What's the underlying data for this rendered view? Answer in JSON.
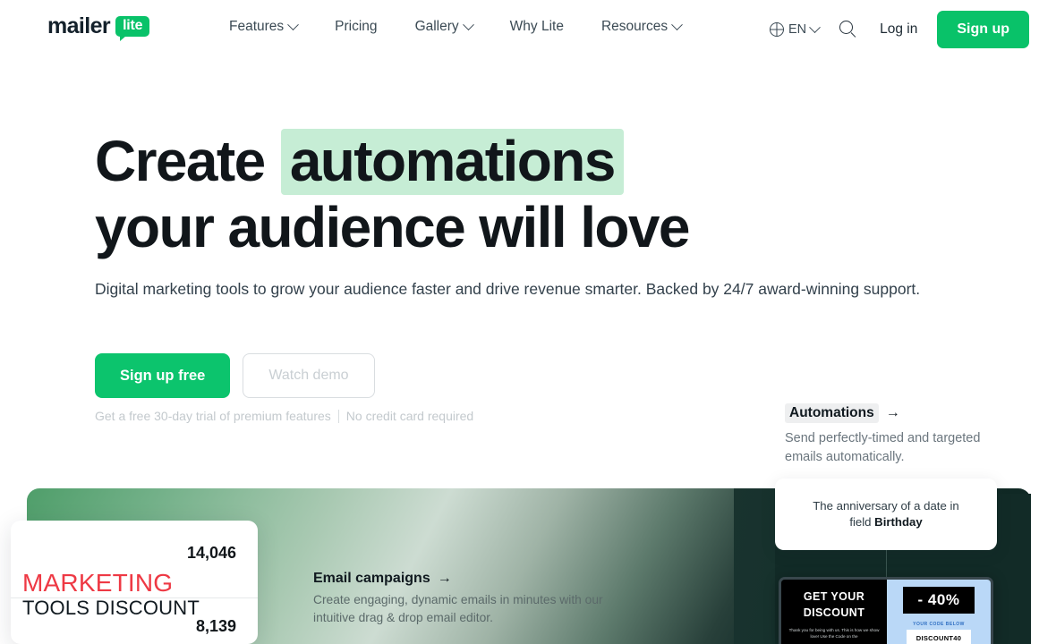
{
  "nav": {
    "logo": {
      "word": "mailer",
      "badge": "lite"
    },
    "links": [
      {
        "label": "Features",
        "has_chevron": true
      },
      {
        "label": "Pricing",
        "has_chevron": false
      },
      {
        "label": "Gallery",
        "has_chevron": true
      },
      {
        "label": "Why Lite",
        "has_chevron": false
      },
      {
        "label": "Resources",
        "has_chevron": true
      }
    ],
    "language": "EN",
    "search_icon": "search-icon",
    "login_label": "Log in",
    "signup_label": "Sign up",
    "accent_color": "#09c269"
  },
  "hero": {
    "title_part1": "Create",
    "title_highlight": "automations",
    "title_part2": "your audience will love",
    "highlight_color": "#c6edd5",
    "subtitle": "Digital marketing tools to grow your audience faster and drive revenue smarter. Backed by 24/7 award-winning support.",
    "primary_button": "Sign up free",
    "secondary_button": "Watch demo",
    "note_left": "Get a free 30-day trial of premium features",
    "note_right": "No credit card required"
  },
  "automations": {
    "badge": "Automations",
    "arrow": "→",
    "description": "Send perfectly-timed and targeted emails automatically."
  },
  "email_campaigns": {
    "heading": "Email campaigns",
    "arrow": "→",
    "description": "Create engaging, dynamic emails in minutes with our intuitive drag & drop email editor."
  },
  "tooltip": {
    "line1": "The anniversary of a date in",
    "line2_prefix": "field ",
    "line2_bold": "Birthday"
  },
  "marketing_card": {
    "number_top": "14,046",
    "title_line1": "MARKETING",
    "title_line2": "TOOLS DISCOUNT",
    "number_bottom": "8,139",
    "title_color": "#ee3944"
  },
  "discount_preview": {
    "headline_line1": "GET YOUR",
    "headline_line2": "DISCOUNT",
    "body_text": "Thank you for being with us. This is how we show love! Use the Code on the",
    "percent": "- 40%",
    "code_label": "YOUR CODE BELOW",
    "code_value": "DISCOUNT40"
  }
}
